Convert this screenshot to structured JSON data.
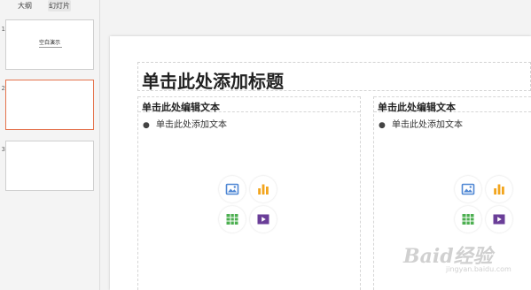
{
  "tabs": {
    "outline": "大纲",
    "slides": "幻灯片"
  },
  "thumbnails": [
    {
      "number": "1",
      "title": "空白演示",
      "active": false
    },
    {
      "number": "2",
      "active": true
    },
    {
      "number": "3",
      "active": false
    }
  ],
  "slide": {
    "title_placeholder": "单击此处添加标题",
    "left": {
      "heading": "单击此处编辑文本",
      "bullet": "单击此处添加文本"
    },
    "right": {
      "heading": "单击此处编辑文本",
      "bullet": "单击此处添加文本"
    }
  },
  "insert_icons": [
    "picture-icon",
    "chart-icon",
    "table-icon",
    "video-icon"
  ],
  "colors": {
    "accent": "#e4734d",
    "picture": "#4f87d4",
    "chart": "#f2a51d",
    "table": "#4caf50",
    "video": "#6a3e98"
  },
  "watermark": {
    "main": "Baid经验",
    "sub": "jingyan.baidu.com"
  }
}
